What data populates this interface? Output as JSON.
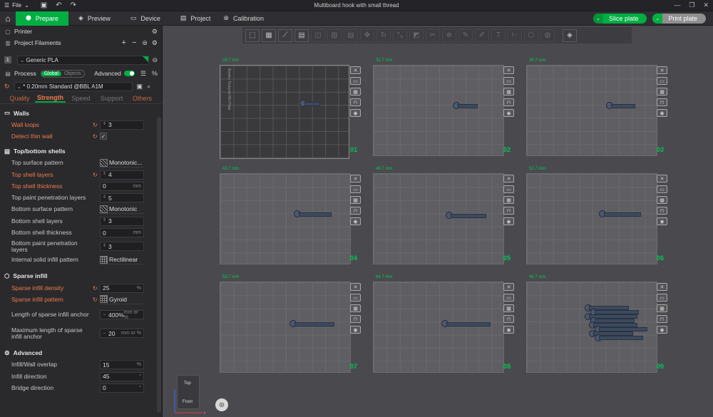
{
  "titlebar": {
    "menu_label": "File",
    "title": "Multiboard hook with small thread"
  },
  "tabs": [
    {
      "label": "Prepare"
    },
    {
      "label": "Preview"
    },
    {
      "label": "Device"
    },
    {
      "label": "Project"
    },
    {
      "label": "Calibration"
    }
  ],
  "actions": {
    "slice": "Slice plate",
    "print": "Print plate"
  },
  "sidebar": {
    "printer_label": "Printer",
    "filaments_label": "Project Filaments",
    "filament_index": "1",
    "filament_name": "Generic PLA",
    "filament_color": "#00ae42",
    "process_label": "Process",
    "global_label": "Global",
    "objects_label": "Objects",
    "advanced_label": "Advanced",
    "preset_name": "* 0.20mm Standard @BBL A1M",
    "subtabs": [
      "Quality",
      "Strength",
      "Speed",
      "Support",
      "Others"
    ],
    "sections": {
      "walls": "Walls",
      "topbottom": "Top/bottom shells",
      "infill": "Sparse infill",
      "advanced": "Advanced"
    },
    "params": {
      "wall_loops": {
        "label": "Wall loops",
        "value": "3"
      },
      "detect_thin_wall": {
        "label": "Detect thin wall",
        "checked": "✓"
      },
      "top_surface_pattern": {
        "label": "Top surface pattern",
        "value": "Monotonic..."
      },
      "top_shell_layers": {
        "label": "Top shell layers",
        "value": "4"
      },
      "top_shell_thickness": {
        "label": "Top shell thickness",
        "value": "0",
        "unit": "mm"
      },
      "top_paint_penetration": {
        "label": "Top paint penetration layers",
        "value": "5"
      },
      "bottom_surface_pattern": {
        "label": "Bottom surface pattern",
        "value": "Monotonic"
      },
      "bottom_shell_layers": {
        "label": "Bottom shell layers",
        "value": "3"
      },
      "bottom_shell_thickness": {
        "label": "Bottom shell thickness",
        "value": "0",
        "unit": "mm"
      },
      "bottom_paint_penetration": {
        "label": "Bottom paint penetration layers",
        "value": "3"
      },
      "internal_solid_infill": {
        "label": "Internal solid infill pattern",
        "value": "Rectilinear"
      },
      "sparse_infill_density": {
        "label": "Sparse infill density",
        "value": "25",
        "unit": "%"
      },
      "sparse_infill_pattern": {
        "label": "Sparse infill pattern",
        "value": "Gyroid"
      },
      "sparse_anchor_len": {
        "label": "Length of sparse infill anchor",
        "value": "400%",
        "unit": "mm or %"
      },
      "sparse_anchor_max": {
        "label": "Maximum length of sparse infill anchor",
        "value": "20",
        "unit": "mm or %"
      },
      "infill_wall_overlap": {
        "label": "Infill/Wall overlap",
        "value": "15",
        "unit": "%"
      },
      "infill_direction": {
        "label": "Infill direction",
        "value": "45",
        "unit": "°"
      },
      "bridge_direction": {
        "label": "Bridge direction",
        "value": "0",
        "unit": "°"
      }
    }
  },
  "plates": [
    {
      "height": "28.7 mm",
      "num": "01"
    },
    {
      "height": "32.7 mm",
      "num": "02"
    },
    {
      "height": "36.7 mm",
      "num": "03"
    },
    {
      "height": "42.7 mm",
      "num": "04"
    },
    {
      "height": "48.7 mm",
      "num": "05"
    },
    {
      "height": "52.7 mm",
      "num": "06"
    },
    {
      "height": "58.7 mm",
      "num": "07"
    },
    {
      "height": "64.7 mm",
      "num": "08"
    },
    {
      "height": "48.7 mm",
      "num": "09"
    }
  ],
  "plate1_label": "Bambu Textured PEI Plate",
  "navcube": {
    "top": "Top",
    "front": "Front"
  }
}
